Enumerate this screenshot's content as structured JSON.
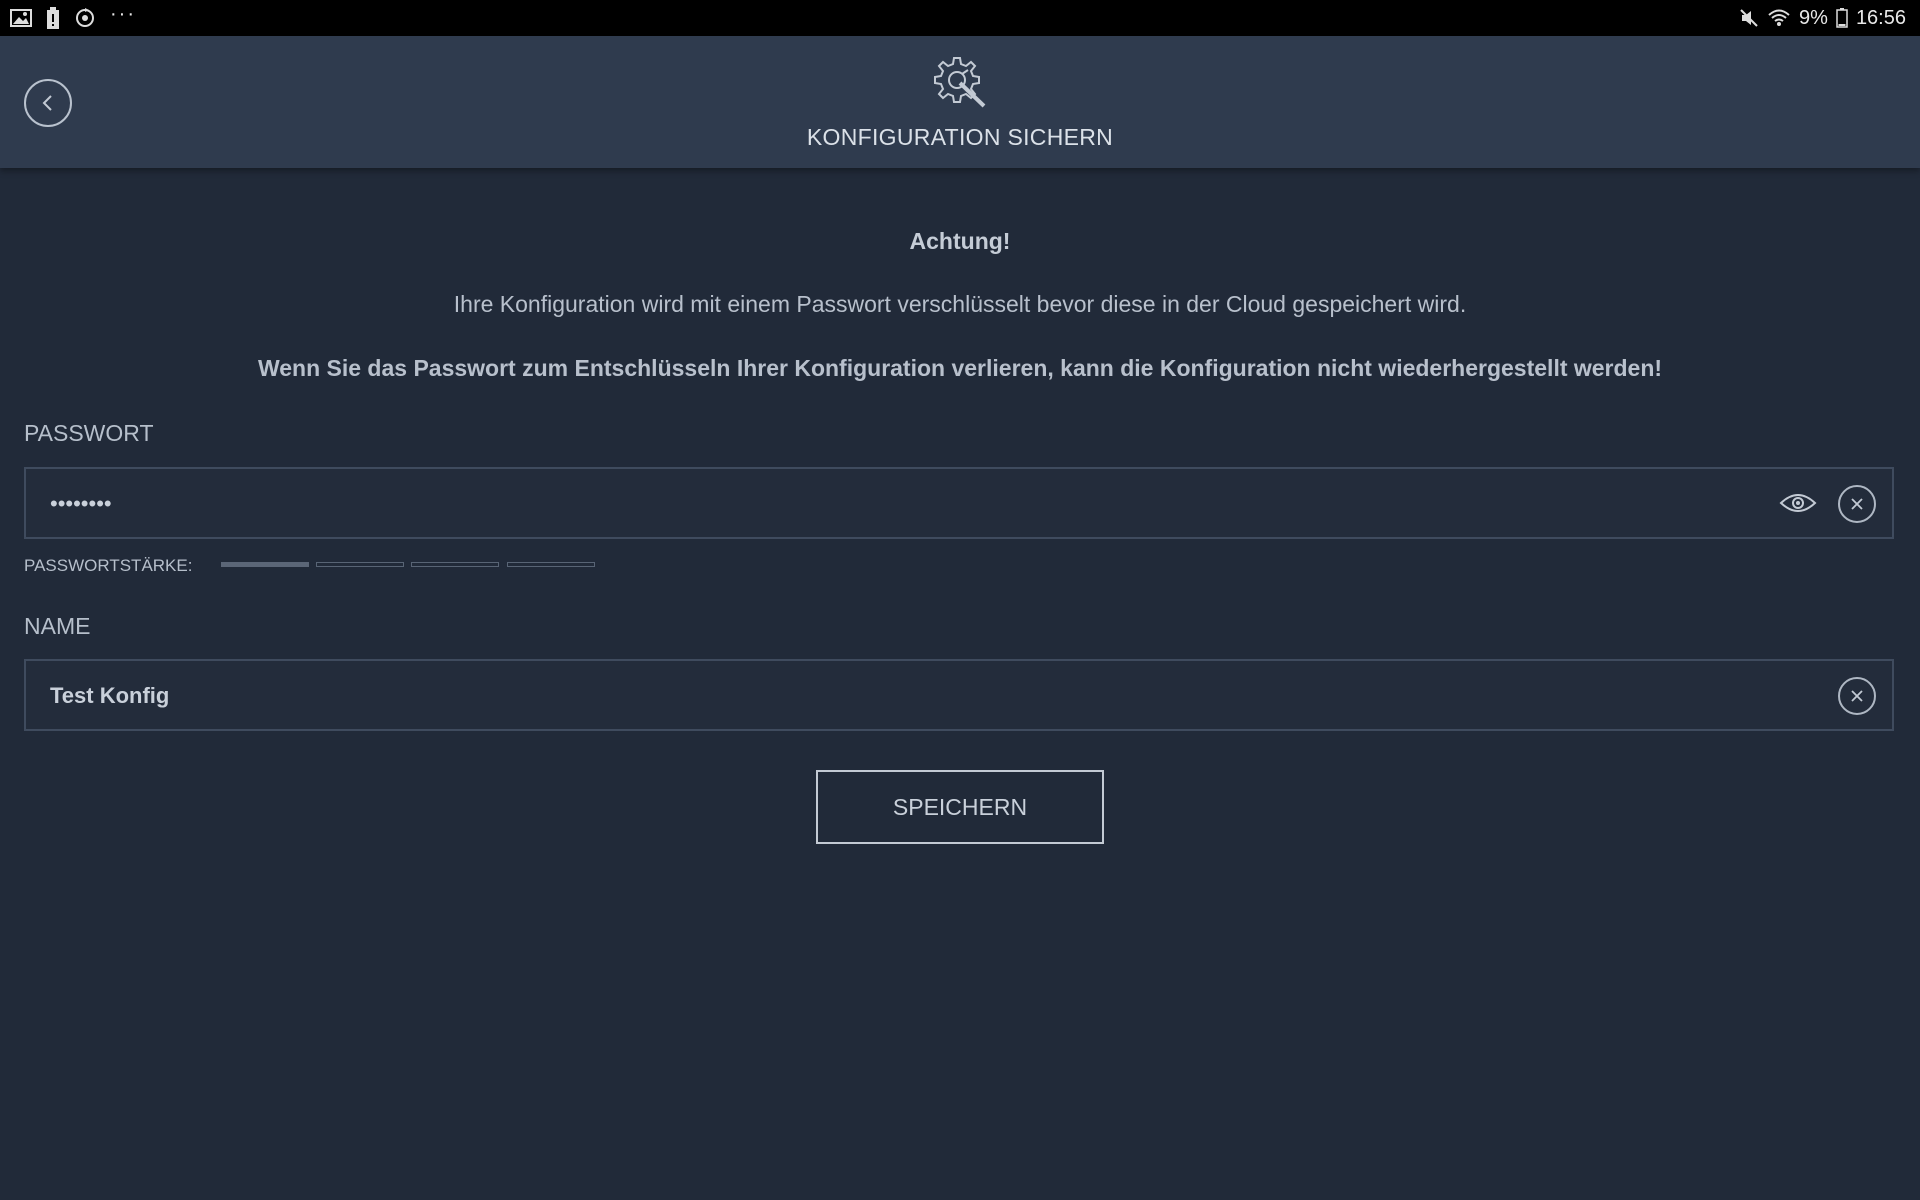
{
  "status_bar": {
    "left_icons": [
      "gallery-icon",
      "battery-alert-icon",
      "sync-icon"
    ],
    "more": "···",
    "right_icons": [
      "mute-icon",
      "wifi-icon"
    ],
    "battery_percent": "9%",
    "time": "16:56"
  },
  "header": {
    "title": "KONFIGURATION SICHERN",
    "icon": "gear-wrench-icon",
    "back_icon": "back-chevron-icon"
  },
  "warning": {
    "title": "Achtung!",
    "text": "Ihre Konfiguration wird mit einem Passwort verschlüsselt bevor diese in der Cloud gespeichert wird.",
    "bold_text": "Wenn Sie das Passwort zum Entschlüsseln Ihrer Konfiguration verlieren, kann die Konfiguration nicht wiederhergestellt werden!"
  },
  "password": {
    "label": "PASSWORT",
    "value": "••••••••",
    "strength_label": "PASSWORTSTÄRKE:",
    "strength_level": 1,
    "strength_max": 4
  },
  "name": {
    "label": "NAME",
    "value": "Test Konfig"
  },
  "save_button": {
    "label": "SPEICHERN"
  },
  "colors": {
    "background": "#212a39",
    "header": "#2f3b4e",
    "text": "#c9d0da"
  }
}
